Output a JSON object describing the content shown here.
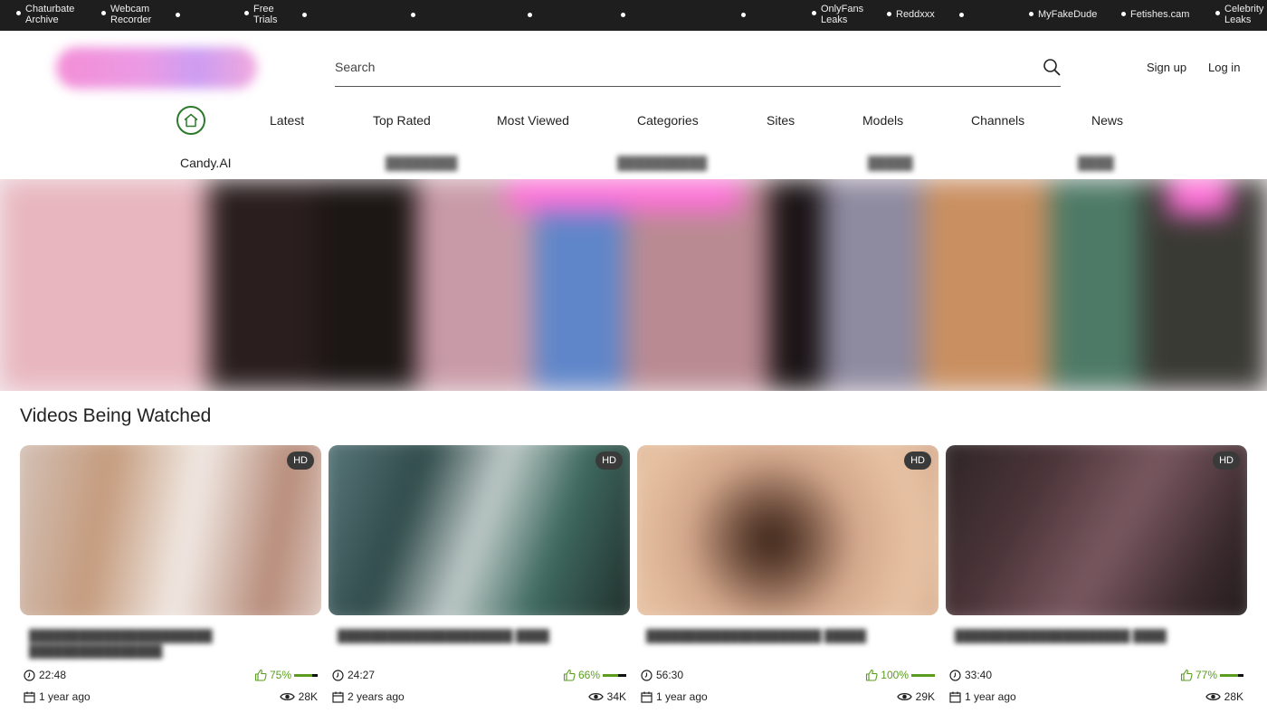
{
  "topbar": {
    "links": [
      {
        "line1": "Chaturbate",
        "line2": "Archive"
      },
      {
        "line1": "Webcam",
        "line2": "Recorder"
      },
      {
        "line1": "Free",
        "line2": "Trials"
      },
      {
        "line1": "OnlyFans",
        "line2": "Leaks"
      },
      {
        "line1": "Reddxxx",
        "line2": ""
      },
      {
        "line1": "MyFakeDude",
        "line2": ""
      },
      {
        "line1": "Fetishes.cam",
        "line2": ""
      },
      {
        "line1": "Celebrity",
        "line2": "Leaks"
      }
    ]
  },
  "header": {
    "search_placeholder": "Search",
    "signup_label": "Sign up",
    "login_label": "Log in"
  },
  "nav": {
    "items": [
      "Latest",
      "Top Rated",
      "Most Viewed",
      "Categories",
      "Sites",
      "Models",
      "Channels",
      "News"
    ]
  },
  "subnav": {
    "items": [
      "Candy.AI"
    ]
  },
  "section": {
    "title": "Videos Being Watched"
  },
  "videos": [
    {
      "badge": "HD",
      "duration": "22:48",
      "rating": "75%",
      "rating_value": 0.75,
      "age": "1 year ago",
      "views": "28K"
    },
    {
      "badge": "HD",
      "duration": "24:27",
      "rating": "66%",
      "rating_value": 0.66,
      "age": "2 years ago",
      "views": "34K"
    },
    {
      "badge": "HD",
      "duration": "56:30",
      "rating": "100%",
      "rating_value": 1.0,
      "age": "1 year ago",
      "views": "29K"
    },
    {
      "badge": "HD",
      "duration": "33:40",
      "rating": "77%",
      "rating_value": 0.77,
      "age": "1 year ago",
      "views": "28K"
    }
  ],
  "colors": {
    "topbar_bg": "#1e1e1e",
    "accent_green": "#5a9c1e",
    "home_ring": "#2d7a2d",
    "badge_bg": "#3a3a3a"
  }
}
